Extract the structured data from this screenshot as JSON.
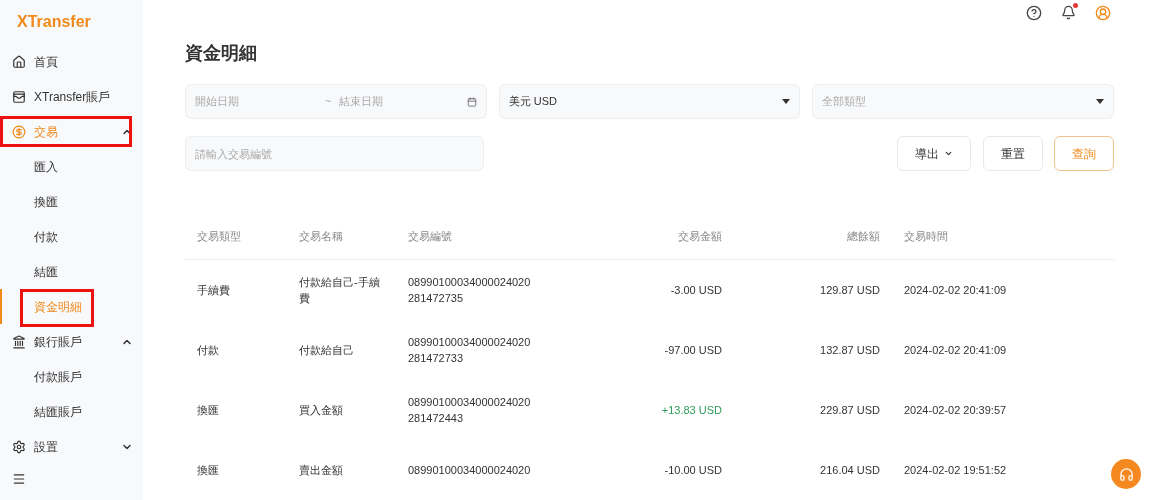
{
  "sidebar": {
    "logo": "XTransfer",
    "items": [
      {
        "label": "首頁",
        "selected": false,
        "highlighted": false
      },
      {
        "label": "XTransfer賬戶",
        "selected": false,
        "highlighted": false
      },
      {
        "label": "交易",
        "selected": true,
        "highlighted": true,
        "expanded": true,
        "children": [
          {
            "label": "匯入",
            "selected": false,
            "highlighted": false
          },
          {
            "label": "換匯",
            "selected": false,
            "highlighted": false
          },
          {
            "label": "付款",
            "selected": false,
            "highlighted": false
          },
          {
            "label": "結匯",
            "selected": false,
            "highlighted": false
          },
          {
            "label": "資金明細",
            "selected": true,
            "highlighted": true
          }
        ]
      },
      {
        "label": "銀行賬戶",
        "selected": false,
        "highlighted": false,
        "expanded": true,
        "children": [
          {
            "label": "付款賬戶",
            "selected": false,
            "highlighted": false
          },
          {
            "label": "結匯賬戶",
            "selected": false,
            "highlighted": false
          }
        ]
      },
      {
        "label": "設置",
        "selected": false,
        "highlighted": false,
        "expanded": false
      }
    ]
  },
  "header": {
    "notification_dot": true
  },
  "page_title": "資金明細",
  "filters": {
    "start_date": {
      "placeholder": "開始日期"
    },
    "separator": "~",
    "end_date": {
      "placeholder": "結束日期"
    },
    "currency": {
      "value": "美元 USD"
    },
    "type": {
      "placeholder": "全部類型"
    },
    "transaction_no": {
      "placeholder": "請輸入交易編號"
    }
  },
  "buttons": {
    "export": "導出",
    "reset": "重置",
    "query": "查詢"
  },
  "table": {
    "columns": [
      "交易類型",
      "交易名稱",
      "交易編號",
      "交易金額",
      "總餘額",
      "交易時間"
    ],
    "rows": [
      {
        "type": "手續費",
        "name": "付款給自己-手續費",
        "number": [
          "08990100034000024020",
          "281472735"
        ],
        "amount": "-3.00 USD",
        "positive": false,
        "balance": "129.87 USD",
        "time": "2024-02-02 20:41:09"
      },
      {
        "type": "付款",
        "name": "付款給自己",
        "number": [
          "08990100034000024020",
          "281472733"
        ],
        "amount": "-97.00 USD",
        "positive": false,
        "balance": "132.87 USD",
        "time": "2024-02-02 20:41:09"
      },
      {
        "type": "換匯",
        "name": "買入金額",
        "number": [
          "08990100034000024020",
          "281472443"
        ],
        "amount": "+13.83 USD",
        "positive": true,
        "balance": "229.87 USD",
        "time": "2024-02-02 20:39:57"
      },
      {
        "type": "換匯",
        "name": "賣出金額",
        "number": [
          "08990100034000024020"
        ],
        "amount": "-10.00 USD",
        "positive": false,
        "balance": "216.04 USD",
        "time": "2024-02-02 19:51:52"
      }
    ]
  }
}
